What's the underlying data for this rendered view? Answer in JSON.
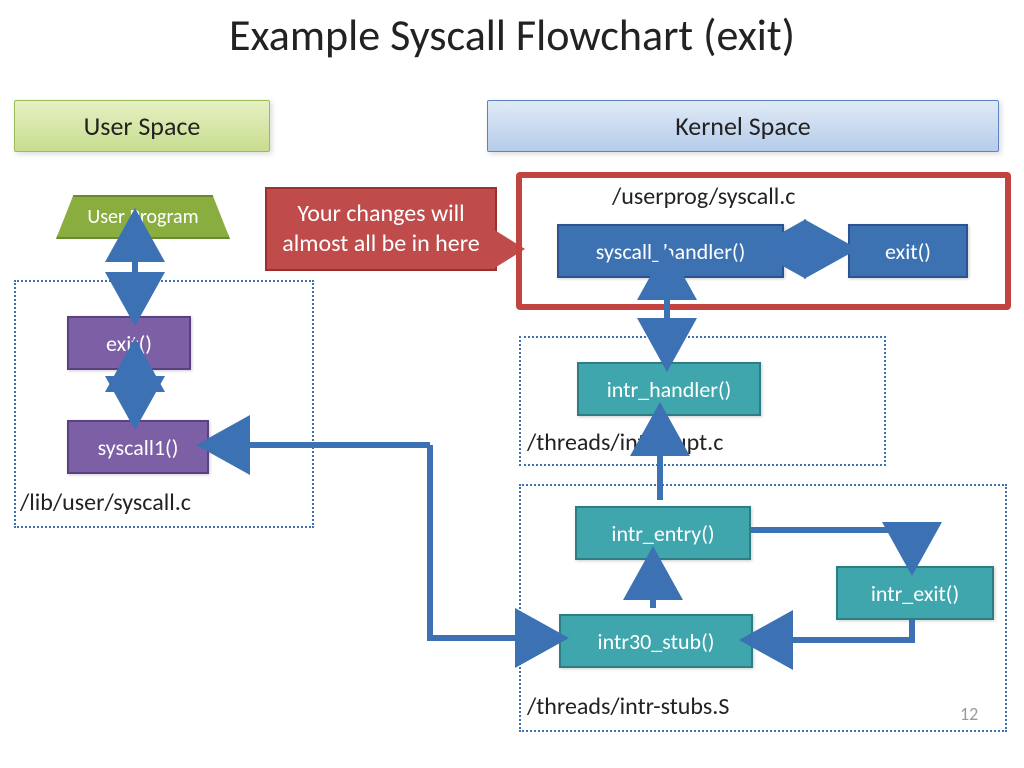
{
  "title": "Example Syscall Flowchart (exit)",
  "headers": {
    "user_space": "User Space",
    "kernel_space": "Kernel Space"
  },
  "user_program": "User Program",
  "boxes": {
    "exit_user": "exit()",
    "syscall1": "syscall1()",
    "syscall_handler": "syscall_handler()",
    "exit_kernel": "exit()",
    "intr_handler": "intr_handler()",
    "intr_entry": "intr_entry()",
    "intr_exit": "intr_exit()",
    "intr30_stub": "intr30_stub()"
  },
  "captions": {
    "lib_user": "/lib/user/syscall.c",
    "userprog": "/userprog/syscall.c",
    "interrupt": "/threads/interrupt.c",
    "intr_stubs": "/threads/intr-stubs.S"
  },
  "callout": "Your changes will almost all be in here",
  "page_number": "12",
  "colors": {
    "arrow": "#3c72b4",
    "highlight": "#c24440"
  }
}
